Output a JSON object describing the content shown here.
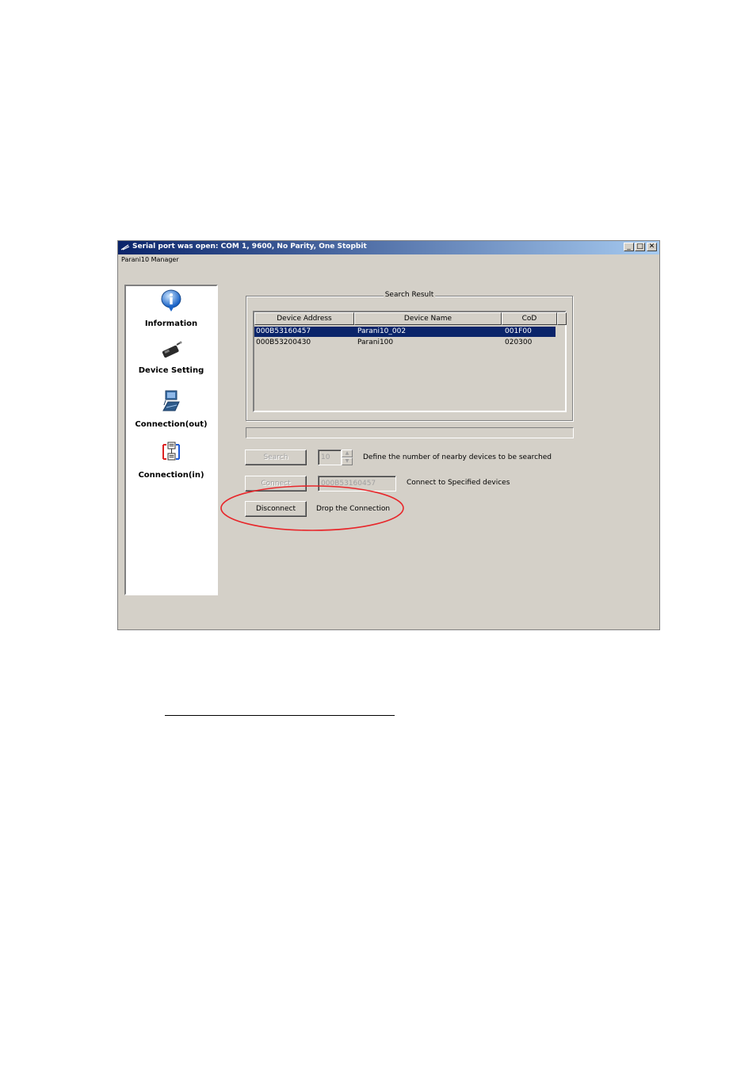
{
  "window": {
    "title": "Serial port was open: COM 1, 9600, No Parity, One Stopbit",
    "menu_label": "Parani10 Manager",
    "controls": {
      "minimize": "_",
      "maximize": "□",
      "close": "✕"
    }
  },
  "sidebar": {
    "items": [
      {
        "label": "Information",
        "icon": "info-icon"
      },
      {
        "label": "Device Setting",
        "icon": "device-setting-icon"
      },
      {
        "label": "Connection(out)",
        "icon": "connection-out-icon",
        "selected": true
      },
      {
        "label": "Connection(in)",
        "icon": "connection-in-icon"
      }
    ]
  },
  "search_result": {
    "legend": "Search Result",
    "columns": [
      "Device Address",
      "Device Name",
      "CoD"
    ],
    "rows": [
      {
        "address": "000B53160457",
        "name": "Parani10_002",
        "cod": "001F00",
        "selected": true
      },
      {
        "address": "000B53200430",
        "name": "Parani100",
        "cod": "020300",
        "selected": false
      }
    ]
  },
  "controls": {
    "search_label": "Search",
    "search_count": "10",
    "search_desc": "Define the number of nearby devices to be searched",
    "connect_label": "Connect",
    "connect_address": "000B53160457",
    "connect_desc": "Connect to Specified devices",
    "disconnect_label": "Disconnect",
    "disconnect_desc": "Drop the Connection"
  },
  "colors": {
    "selection": "#0a246a",
    "annotation": "#e8262a",
    "face": "#d4d0c8"
  }
}
